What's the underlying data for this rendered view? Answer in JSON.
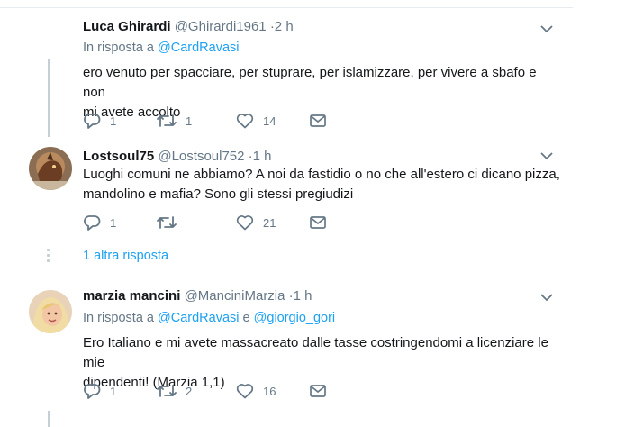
{
  "tweets": [
    {
      "name": "Luca Ghirardi",
      "handle": "@Ghirardi1961 ·2 h",
      "reply_prefix": "In risposta a",
      "mentions": [
        "@CardRavasi"
      ],
      "text_lines": [
        "ero venuto per spacciare, per stuprare, per islamizzare, per vivere a sbafo e non",
        "mi avete accolto"
      ],
      "replies": "1",
      "retweets": "1",
      "likes": "14"
    },
    {
      "name": "Lostsoul75",
      "handle": "@Lostsoul752 ·1 h",
      "text_lines": [
        "Luoghi comuni ne abbiamo? A noi da fastidio o no che all'estero ci dicano pizza,",
        "mandolino e mafia? Sono gli stessi pregiudizi"
      ],
      "replies": "1",
      "retweets": "",
      "likes": "21",
      "more_replies": "1 altra risposta"
    },
    {
      "name": "marzia mancini",
      "handle": "@ManciniMarzia ·1 h",
      "reply_prefix": "In risposta a",
      "mentions": [
        "@CardRavasi",
        "@giorgio_gori"
      ],
      "mention_joiner": "e",
      "text_lines": [
        "Ero Italiano e mi avete massacreato dalle tasse costringendomi a licenziare le mie",
        "dipendenti! (Marzia 1,1)"
      ],
      "replies": "1",
      "retweets": "2",
      "likes": "16"
    }
  ],
  "colors": {
    "accent": "#1da1f2",
    "muted": "#657786",
    "text": "#14171a",
    "thread": "#c4cfd6",
    "border": "#e6ecf0"
  },
  "icons": [
    "reply-icon",
    "retweet-icon",
    "like-icon",
    "dm-icon",
    "chevron-down-icon"
  ]
}
